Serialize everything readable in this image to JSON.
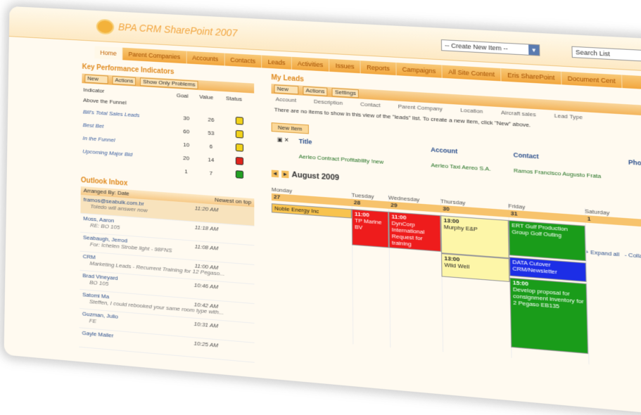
{
  "site": {
    "title": "BPA CRM SharePoint 2007",
    "create_label": "-- Create New Item --",
    "search_label": "Search List"
  },
  "tabs": [
    "Home",
    "Parent Companies",
    "Accounts",
    "Contacts",
    "Leads",
    "Activities",
    "Issues",
    "Reports",
    "Campaigns",
    "All Site Content",
    "Eris SharePoint",
    "Document Cent"
  ],
  "kpi": {
    "title": "Key Performance Indicators",
    "toolbar": {
      "new": "New",
      "actions": "Actions",
      "show_only": "Show Only Problems"
    },
    "headers": {
      "indicator": "Indicator",
      "goal": "Goal",
      "value": "Value",
      "status": "Status"
    },
    "group": "Above the Funnel",
    "rows": [
      {
        "name": "Bill's Total Sales Leads",
        "goal": "30",
        "value": "26",
        "color": "#f2d21a"
      },
      {
        "name": "Best Bet",
        "goal": "60",
        "value": "53",
        "color": "#f2d21a"
      },
      {
        "name": "In the Funnel",
        "goal": "10",
        "value": "6",
        "color": "#f2d21a"
      },
      {
        "name": "Upcoming Major Bid",
        "goal": "20",
        "value": "14",
        "color": "#e0241c"
      },
      {
        "name": "",
        "goal": "1",
        "value": "7",
        "color": "#22a022"
      }
    ]
  },
  "inbox": {
    "title": "Outlook Inbox",
    "arranged": "Arranged By: Date",
    "order": "Newest on top",
    "mails": [
      {
        "from": "framos@seabulk.com.br",
        "snip": "Toledo will answer now",
        "time": "11:20 AM"
      },
      {
        "from": "Moss, Aaron",
        "snip": "RE: BO 105",
        "time": "11:18 AM"
      },
      {
        "from": "Seabaugh, Jerrod",
        "snip": "For: Ichelen Strobe light - 98FNS",
        "time": "11:08 AM"
      },
      {
        "from": "CRM",
        "snip": "Marketing Leads - Recurrent Training for 12 Pegaso...",
        "time": "11:00 AM"
      },
      {
        "from": "Brad Vineyard",
        "snip": "BO 105",
        "time": "10:46 AM"
      },
      {
        "from": "Satomi Ma",
        "snip": "Steffen, I could rebooked your same room type with...",
        "time": "10:42 AM"
      },
      {
        "from": "Guzman, Julio",
        "snip": "FE",
        "time": "10:31 AM"
      },
      {
        "from": "Gayle Mailer",
        "snip": "",
        "time": "10:25 AM"
      }
    ]
  },
  "leads": {
    "title": "My Leads",
    "toolbar": {
      "new": "New",
      "actions": "Actions",
      "settings": "Settings"
    },
    "columns": [
      "Account",
      "Description",
      "Contact",
      "Parent Company",
      "Location",
      "Aircraft sales",
      "Lead Type"
    ],
    "empty": "There are no items to show in this view of the \"leads\" list. To create a new item, click \"New\" above.",
    "new_item": "New Item",
    "grid_headers": {
      "title": "Title",
      "account": "Account",
      "contact": "Contact",
      "phone": "Phone"
    },
    "row": {
      "title": "Aerleo Contract Profitability !new",
      "account": "Aerleo Taxi Aereo S.A.",
      "contact": "Ramos Francisco Augusto Frata"
    }
  },
  "calendar": {
    "month": "August 2009",
    "expand": "+ Expand all",
    "collapse": "- Collapse",
    "days": [
      {
        "name": "Monday",
        "num": "27"
      },
      {
        "name": "Tuesday",
        "num": "28"
      },
      {
        "name": "Wednesday",
        "num": "29"
      },
      {
        "name": "Thursday",
        "num": "30"
      },
      {
        "name": "Friday",
        "num": "31"
      },
      {
        "name": "Saturday",
        "num": "1"
      }
    ],
    "events": [
      {
        "label": "Noble Energy Inc",
        "time": ""
      },
      {
        "label": "TP Marine BV",
        "time": "11:00"
      },
      {
        "label": "DynCorp International Request for training",
        "time": "11:00"
      },
      {
        "label": "Murphy E&P",
        "time": "13:00"
      },
      {
        "label": "Wild Well",
        "time": "13:00"
      },
      {
        "label": "ERT Gulf Production Group Golf Outing",
        "time": ""
      },
      {
        "label": "DATA Cutover CRM/Newsletter",
        "time": ""
      },
      {
        "label": "Develop proposal for consignment inventory for 2 Pegaso EB135",
        "time": "15:00"
      }
    ]
  }
}
